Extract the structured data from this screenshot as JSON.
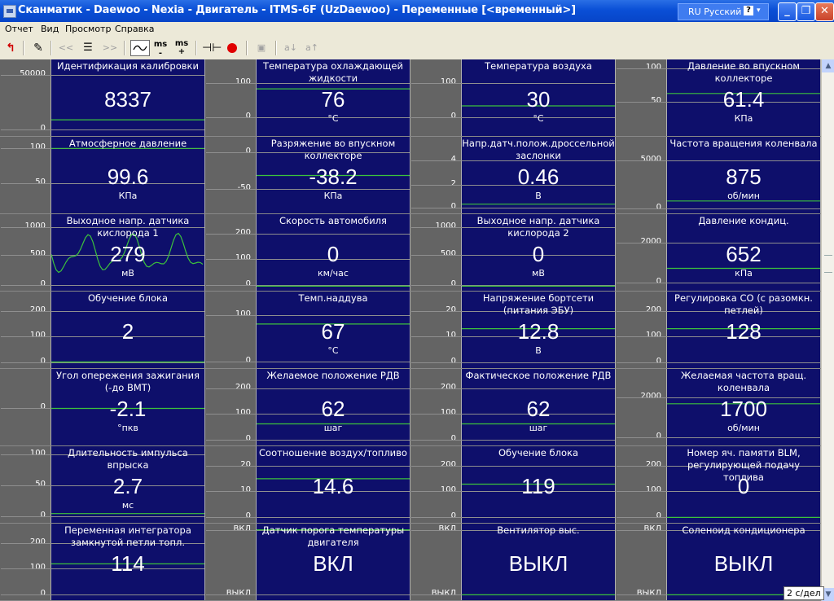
{
  "window": {
    "title": "Сканматик - Daewoo - Nexia - Двигатель - ITMS-6F (UzDaewoo) - Переменные [<временный>]",
    "language": "RU Русский",
    "help_glyph": "?",
    "minimize": "_",
    "restore": "❐",
    "close": "✕"
  },
  "menu": {
    "items": [
      "Отчет",
      "Вид",
      "Просмотр",
      "Справка"
    ]
  },
  "toolbar": {
    "back_left": "<<",
    "back_right": ">>",
    "ms_minus": "ms\n-",
    "ms_plus": "ms\n+",
    "sort_down": "a↓",
    "sort_up": "a↑"
  },
  "scale_labels": {
    "on": "ВКЛ",
    "off": "ВЫКЛ"
  },
  "status": {
    "time_per_div": "2 с/дел"
  },
  "colors": {
    "panel_bg": "#0e0f6b",
    "trace": "#3cc23c",
    "scale_bg": "#646464"
  },
  "sensors": [
    {
      "title": "Идентификация калибровки",
      "value": "8337",
      "unit": "",
      "ticks": [
        {
          "t": "50000",
          "f": 0.2
        },
        {
          "t": "0",
          "f": 0.9
        }
      ],
      "lvl": 0.78
    },
    {
      "title": "Температура охлаждающей жидкости",
      "value": "76",
      "unit": "°С",
      "ticks": [
        {
          "t": "100",
          "f": 0.3
        },
        {
          "t": "0",
          "f": 0.75
        }
      ],
      "lvl": 0.38
    },
    {
      "title": "Температура воздуха",
      "value": "30",
      "unit": "°С",
      "ticks": [
        {
          "t": "100",
          "f": 0.3
        },
        {
          "t": "0",
          "f": 0.75
        }
      ],
      "lvl": 0.6
    },
    {
      "title": "Давление во впускном коллекторе",
      "value": "61.4",
      "unit": "КПа",
      "ticks": [
        {
          "t": "100",
          "f": 0.12
        },
        {
          "t": "50",
          "f": 0.55
        }
      ],
      "lvl": 0.44
    },
    {
      "title": "Атмосферное давление",
      "value": "99.6",
      "unit": "КПа",
      "ticks": [
        {
          "t": "100",
          "f": 0.15
        },
        {
          "t": "50",
          "f": 0.6
        }
      ],
      "lvl": 0.15
    },
    {
      "title": "Разряжение во впускном коллекторе",
      "value": "-38.2",
      "unit": "КПа",
      "ticks": [
        {
          "t": "0",
          "f": 0.2
        },
        {
          "t": "-50",
          "f": 0.67
        }
      ],
      "lvl": 0.5
    },
    {
      "title": "Напр.датч.полож.дроссельной заслонки",
      "value": "0.46",
      "unit": "В",
      "ticks": [
        {
          "t": "4",
          "f": 0.3
        },
        {
          "t": "2",
          "f": 0.62
        },
        {
          "t": "0",
          "f": 0.92
        }
      ],
      "lvl": 0.87
    },
    {
      "title": "Частота вращения коленвала",
      "value": "875",
      "unit": "об/мин",
      "ticks": [
        {
          "t": "5000",
          "f": 0.3
        },
        {
          "t": "0",
          "f": 0.93
        }
      ],
      "lvl": 0.83
    },
    {
      "title": "Выходное напр. датчика кислорода 1",
      "value": "279",
      "unit": "мВ",
      "ticks": [
        {
          "t": "1000",
          "f": 0.17
        },
        {
          "t": "500",
          "f": 0.53
        },
        {
          "t": "0",
          "f": 0.92
        }
      ],
      "lvl": 0.52,
      "wave": true
    },
    {
      "title": "Скорость автомобиля",
      "value": "0",
      "unit": "км/час",
      "ticks": [
        {
          "t": "200",
          "f": 0.25
        },
        {
          "t": "100",
          "f": 0.58
        },
        {
          "t": "0",
          "f": 0.92
        }
      ],
      "lvl": 0.93
    },
    {
      "title": "Выходное напр. датчика кислорода 2",
      "value": "0",
      "unit": "мВ",
      "ticks": [
        {
          "t": "1000",
          "f": 0.17
        },
        {
          "t": "500",
          "f": 0.53
        },
        {
          "t": "0",
          "f": 0.92
        }
      ],
      "lvl": 0.93
    },
    {
      "title": "Давление кондиц.",
      "value": "652",
      "unit": "кПа",
      "ticks": [
        {
          "t": "2000",
          "f": 0.37
        },
        {
          "t": "0",
          "f": 0.88
        }
      ],
      "lvl": 0.7
    },
    {
      "title": "Обучение блока",
      "value": "2",
      "unit": "",
      "ticks": [
        {
          "t": "200",
          "f": 0.25
        },
        {
          "t": "100",
          "f": 0.58
        },
        {
          "t": "0",
          "f": 0.92
        }
      ],
      "lvl": 0.91
    },
    {
      "title": "Темп.наддува",
      "value": "67",
      "unit": "°С",
      "ticks": [
        {
          "t": "100",
          "f": 0.3
        },
        {
          "t": "0",
          "f": 0.9
        }
      ],
      "lvl": 0.42
    },
    {
      "title": "Напряжение бортсети (питания ЭБУ)",
      "value": "12.8",
      "unit": "В",
      "ticks": [
        {
          "t": "20",
          "f": 0.25
        },
        {
          "t": "10",
          "f": 0.58
        },
        {
          "t": "0",
          "f": 0.92
        }
      ],
      "lvl": 0.48
    },
    {
      "title": "Регулировка CO (с разомкн. петлей)",
      "value": "128",
      "unit": "",
      "ticks": [
        {
          "t": "200",
          "f": 0.25
        },
        {
          "t": "100",
          "f": 0.58
        },
        {
          "t": "0",
          "f": 0.92
        }
      ],
      "lvl": 0.48
    },
    {
      "title": "Угол опережения зажигания (-до ВМТ)",
      "value": "-2.1",
      "unit": "°пкв",
      "ticks": [
        {
          "t": "0",
          "f": 0.5
        }
      ],
      "lvl": 0.51
    },
    {
      "title": "Желаемое положение РДВ",
      "value": "62",
      "unit": "шаг",
      "ticks": [
        {
          "t": "200",
          "f": 0.25
        },
        {
          "t": "100",
          "f": 0.58
        },
        {
          "t": "0",
          "f": 0.92
        }
      ],
      "lvl": 0.71
    },
    {
      "title": "Фактическое положение РДВ",
      "value": "62",
      "unit": "шаг",
      "ticks": [
        {
          "t": "200",
          "f": 0.25
        },
        {
          "t": "100",
          "f": 0.58
        },
        {
          "t": "0",
          "f": 0.92
        }
      ],
      "lvl": 0.71
    },
    {
      "title": "Желаемая частота вращ. коленвала",
      "value": "1700",
      "unit": "об/мин",
      "ticks": [
        {
          "t": "2000",
          "f": 0.37
        },
        {
          "t": "0",
          "f": 0.88
        }
      ],
      "lvl": 0.45
    },
    {
      "title": "Длительность импульса впрыска",
      "value": "2.7",
      "unit": "мс",
      "ticks": [
        {
          "t": "100",
          "f": 0.1
        },
        {
          "t": "50",
          "f": 0.5
        },
        {
          "t": "0",
          "f": 0.9
        }
      ],
      "lvl": 0.87
    },
    {
      "title": "Соотношение воздух/топливо",
      "value": "14.6",
      "unit": "",
      "ticks": [
        {
          "t": "20",
          "f": 0.25
        },
        {
          "t": "10",
          "f": 0.58
        },
        {
          "t": "0",
          "f": 0.92
        }
      ],
      "lvl": 0.42
    },
    {
      "title": "Обучение блока",
      "value": "119",
      "unit": "",
      "ticks": [
        {
          "t": "200",
          "f": 0.25
        },
        {
          "t": "100",
          "f": 0.58
        },
        {
          "t": "0",
          "f": 0.92
        }
      ],
      "lvl": 0.49
    },
    {
      "title": "Номер яч. памяти BLM, регулирующей подачу топлива",
      "value": "0",
      "unit": "",
      "ticks": [
        {
          "t": "200",
          "f": 0.25
        },
        {
          "t": "100",
          "f": 0.58
        },
        {
          "t": "0",
          "f": 0.92
        }
      ],
      "lvl": 0.92
    },
    {
      "title": "Переменная интегратора замкнутой петли топл.",
      "value": "114",
      "unit": "",
      "ticks": [
        {
          "t": "200",
          "f": 0.25
        },
        {
          "t": "100",
          "f": 0.58
        },
        {
          "t": "0",
          "f": 0.92
        }
      ],
      "lvl": 0.52
    },
    {
      "title": "Датчик порога температуры двигателя",
      "value": "ВКЛ",
      "unit": "",
      "ticks": [
        {
          "t": "ВКЛ",
          "f": 0.08
        },
        {
          "t": "ВЫКЛ",
          "f": 0.92
        }
      ],
      "lvl": 0.08
    },
    {
      "title": "Вентилятор выс.",
      "value": "ВЫКЛ",
      "unit": "",
      "ticks": [
        {
          "t": "ВКЛ",
          "f": 0.08
        },
        {
          "t": "ВЫКЛ",
          "f": 0.92
        }
      ],
      "lvl": 0.92
    },
    {
      "title": "Соленоид кондиционера",
      "value": "ВЫКЛ",
      "unit": "",
      "ticks": [
        {
          "t": "ВКЛ",
          "f": 0.08
        },
        {
          "t": "ВЫКЛ",
          "f": 0.92
        }
      ],
      "lvl": 0.92
    }
  ]
}
